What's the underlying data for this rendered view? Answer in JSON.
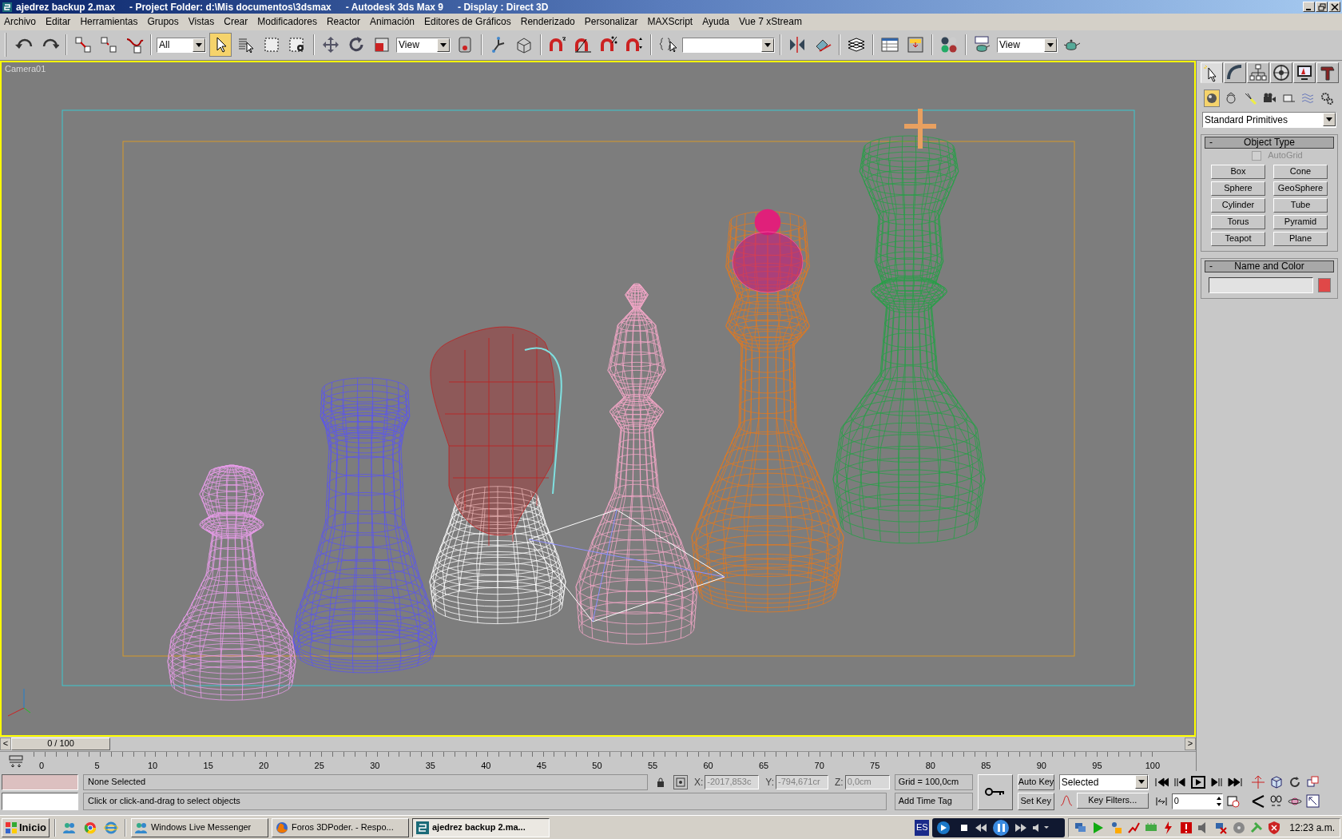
{
  "window": {
    "title_parts": [
      "ajedrez backup 2.max",
      "- Project Folder: d:\\Mis documentos\\3dsmax",
      "- Autodesk 3ds Max 9",
      "- Display : Direct 3D"
    ]
  },
  "menu": [
    "Archivo",
    "Editar",
    "Herramientas",
    "Grupos",
    "Vistas",
    "Crear",
    "Modificadores",
    "Reactor",
    "Animación",
    "Editores de Gráficos",
    "Renderizado",
    "Personalizar",
    "MAXScript",
    "Ayuda",
    "Vue 7 xStream"
  ],
  "toolbar": [
    {
      "kind": "undo",
      "selected": false
    },
    {
      "kind": "redo",
      "selected": false
    },
    {
      "kind": "sep"
    },
    {
      "kind": "link",
      "selected": false
    },
    {
      "kind": "unlink",
      "selected": false
    },
    {
      "kind": "bind",
      "selected": false
    },
    {
      "kind": "sep"
    },
    {
      "kind": "dropdown",
      "value": "All"
    },
    {
      "kind": "select",
      "selected": true
    },
    {
      "kind": "select-by-name",
      "selected": false
    },
    {
      "kind": "region",
      "selected": false
    },
    {
      "kind": "window",
      "selected": false
    },
    {
      "kind": "sep"
    },
    {
      "kind": "move",
      "selected": false
    },
    {
      "kind": "rotate",
      "selected": false
    },
    {
      "kind": "scale",
      "selected": false
    },
    {
      "kind": "dropdown",
      "value": "View"
    },
    {
      "kind": "pivot",
      "selected": false
    },
    {
      "kind": "sep"
    },
    {
      "kind": "manipulate",
      "selected": false
    },
    {
      "kind": "keyboard",
      "selected": false
    },
    {
      "kind": "sep"
    },
    {
      "kind": "snap",
      "selected": false
    },
    {
      "kind": "angle-snap",
      "selected": false
    },
    {
      "kind": "percent-snap",
      "selected": false
    },
    {
      "kind": "spinner-snap",
      "selected": false
    },
    {
      "kind": "sep"
    },
    {
      "kind": "edit-named",
      "selected": false
    },
    {
      "kind": "dropdown"
    },
    {
      "kind": "sep"
    },
    {
      "kind": "mirror",
      "selected": false
    },
    {
      "kind": "align",
      "selected": false
    },
    {
      "kind": "sep"
    },
    {
      "kind": "layers",
      "selected": false
    },
    {
      "kind": "sep"
    },
    {
      "kind": "curve-editor",
      "selected": false
    },
    {
      "kind": "schematic",
      "selected": false
    },
    {
      "kind": "sep"
    },
    {
      "kind": "material",
      "selected": false
    },
    {
      "kind": "sep"
    },
    {
      "kind": "render-setup",
      "selected": false
    },
    {
      "kind": "dropdown",
      "value": "View"
    },
    {
      "kind": "quick-render",
      "selected": false
    }
  ],
  "viewport": {
    "label": "Camera01",
    "active": true
  },
  "command_panel": {
    "tabs": [
      {
        "kind": "create",
        "selected": true
      },
      {
        "kind": "modify",
        "selected": false
      },
      {
        "kind": "hierarchy",
        "selected": false
      },
      {
        "kind": "motion",
        "selected": false
      },
      {
        "kind": "display",
        "selected": false
      },
      {
        "kind": "utilities",
        "selected": false
      }
    ],
    "categories": [
      {
        "kind": "geometry",
        "selected": true
      },
      {
        "kind": "shapes",
        "selected": false
      },
      {
        "kind": "lights",
        "selected": false
      },
      {
        "kind": "cameras",
        "selected": false
      },
      {
        "kind": "helpers",
        "selected": false
      },
      {
        "kind": "space-warps",
        "selected": false
      },
      {
        "kind": "systems",
        "selected": false
      }
    ],
    "dropdown": "Standard Primitives",
    "object_type": {
      "collapse": "-",
      "title": "Object Type",
      "autogrid": {
        "label": "AutoGrid",
        "checked": false,
        "disabled": true
      },
      "buttons": [
        "Box",
        "Cone",
        "Sphere",
        "GeoSphere",
        "Cylinder",
        "Tube",
        "Torus",
        "Pyramid",
        "Teapot",
        "Plane"
      ]
    },
    "name_and_color": {
      "collapse": "-",
      "title": "Name and Color"
    }
  },
  "time_slider": {
    "prev": "<",
    "position": "0 / 100",
    "level": 0,
    "next": ">"
  },
  "trackbar": {
    "ticks": [
      "0",
      "5",
      "10",
      "15",
      "20",
      "25",
      "30",
      "35",
      "40",
      "45",
      "50",
      "55",
      "60",
      "65",
      "70",
      "75",
      "80",
      "85",
      "90",
      "95",
      "100"
    ]
  },
  "status": {
    "selection": "None Selected",
    "prompt": "Click or click-and-drag to select objects",
    "x_label": "X:",
    "x": "-2017,853c",
    "y_label": "Y:",
    "y": "-794,671cr",
    "z_label": "Z:",
    "z": "0,0cm",
    "grid": "Grid = 100,0cm",
    "time_tag": "Add Time Tag",
    "auto_key": "Auto Key",
    "set_key": "Set Key",
    "key_mode": "Selected",
    "key_filters": "Key Filters...",
    "frame": "0"
  },
  "taskbar": {
    "start": "Inicio",
    "tasks": [
      {
        "label": "Windows Live Messenger",
        "kind": "messenger",
        "selected": false
      },
      {
        "label": "Foros 3DPoder. - Respo...",
        "kind": "browser",
        "selected": false
      },
      {
        "label": "ajedrez backup 2.ma...",
        "kind": "max",
        "selected": true
      }
    ],
    "language": "ES",
    "clock": "12:23 a.m."
  }
}
